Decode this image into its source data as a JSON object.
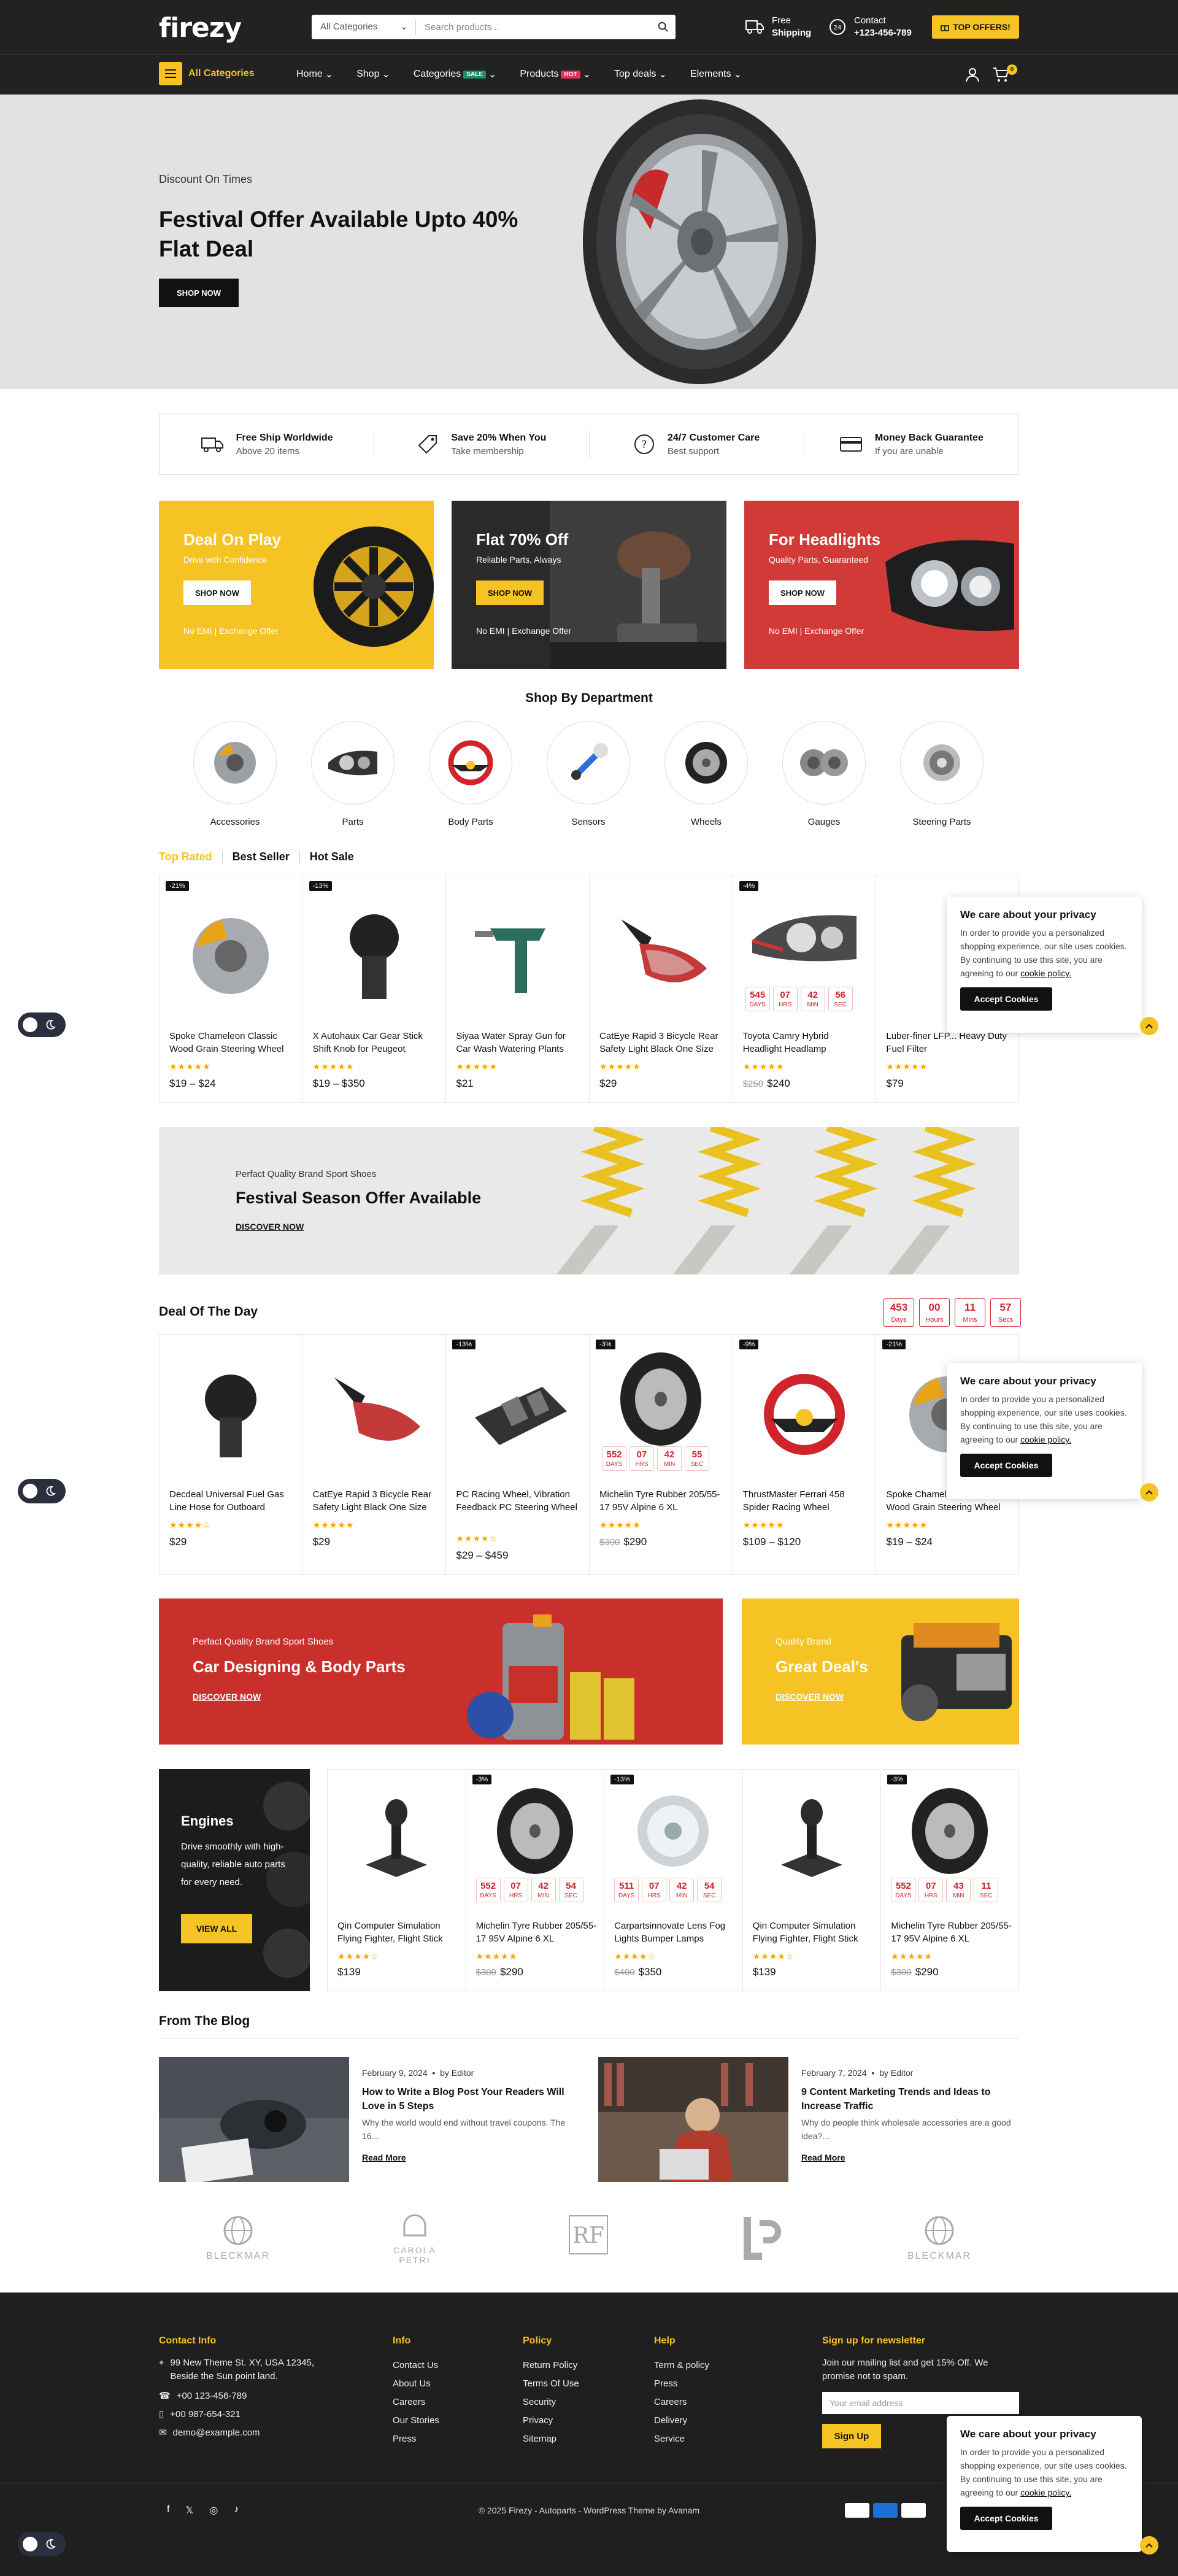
{
  "header": {
    "logo": "firezy",
    "search_category": "All Categories",
    "search_placeholder": "Search products...",
    "shipping_line1": "Free",
    "shipping_line2": "Shipping",
    "contact_line1": "Contact",
    "contact_line2": "+123-456-789",
    "offers_button": "TOP OFFERS!",
    "all_categories": "All Categories",
    "menu": [
      {
        "label": "Home",
        "tag": ""
      },
      {
        "label": "Shop",
        "tag": ""
      },
      {
        "label": "Categories",
        "tag": "SALE"
      },
      {
        "label": "Products",
        "tag": "HOT"
      },
      {
        "label": "Top deals",
        "tag": ""
      },
      {
        "label": "Elements",
        "tag": ""
      }
    ],
    "cart_count": "0",
    "colors": {
      "accent": "#f6c324",
      "dark": "#222222",
      "red": "#d0232a",
      "sale_tag": "#1f8f6a",
      "hot_tag": "#e0325a"
    }
  },
  "hero": {
    "subtitle": "Discount On Times",
    "title": "Festival Offer Available Upto 40% Flat Deal",
    "button": "SHOP NOW"
  },
  "features": [
    {
      "title": "Free Ship Worldwide",
      "sub": "Above 20 items",
      "icon": "truck-icon"
    },
    {
      "title": "Save 20% When You",
      "sub": "Take membership",
      "icon": "tag-icon"
    },
    {
      "title": "24/7 Customer Care",
      "sub": "Best support",
      "icon": "help-icon"
    },
    {
      "title": "Money Back Guarantee",
      "sub": "If you are unable",
      "icon": "card-icon"
    }
  ],
  "promos": [
    {
      "title": "Deal On Play",
      "sub": "Drive with Confidence",
      "button": "SHOP NOW",
      "foot": "No EMI | Exchange Offer"
    },
    {
      "title": "Flat 70% Off",
      "sub": "Reliable Parts, Always",
      "button": "SHOP NOW",
      "foot": "No EMI | Exchange Offer"
    },
    {
      "title": "For Headlights",
      "sub": "Quality Parts, Guaranteed",
      "button": "SHOP NOW",
      "foot": "No EMI | Exchange Offer"
    }
  ],
  "departments": {
    "title": "Shop By Department",
    "items": [
      "Accessories",
      "Parts",
      "Body Parts",
      "Sensors",
      "Wheels",
      "Gauges",
      "Steering Parts"
    ]
  },
  "tabs": [
    "Top Rated",
    "Best Seller",
    "Hot Sale"
  ],
  "top_rated": [
    {
      "name": "Spoke Chameleon Classic Wood Grain Steering Wheel",
      "price": "$19 – $24",
      "old": "",
      "badge": "-21%",
      "stars": "★★★★★"
    },
    {
      "name": "X Autohaux Car Gear Stick Shift Knob for Peugeot",
      "price": "$19 – $350",
      "old": "",
      "badge": "-13%",
      "stars": "★★★★★"
    },
    {
      "name": "Siyaa Water Spray Gun for Car Wash Watering Plants",
      "price": "$21",
      "old": "",
      "badge": "",
      "stars": "★★★★★"
    },
    {
      "name": "CatEye Rapid 3 Bicycle Rear Safety Light Black One Size",
      "price": "$29",
      "old": "",
      "badge": "",
      "stars": "★★★★★"
    },
    {
      "name": "Toyota Camry Hybrid Headlight Headlamp",
      "price": "$240",
      "old": "$250",
      "badge": "-4%",
      "stars": "★★★★★",
      "countdown": [
        [
          "545",
          "DAYS"
        ],
        [
          "07",
          "HRS"
        ],
        [
          "42",
          "MIN"
        ],
        [
          "56",
          "SEC"
        ]
      ]
    },
    {
      "name": "Luber-finer LFP... Heavy Duty Fuel Filter",
      "price": "$79",
      "old": "",
      "badge": "",
      "stars": "★★★★★"
    }
  ],
  "banner1": {
    "sub": "Perfact Quality Brand Sport Shoes",
    "title": "Festival Season Offer Available",
    "link": "DISCOVER NOW"
  },
  "deal": {
    "title": "Deal Of The Day",
    "countdown": [
      [
        "453",
        "Days"
      ],
      [
        "00",
        "Hours"
      ],
      [
        "11",
        "Mins"
      ],
      [
        "57",
        "Secs"
      ]
    ],
    "products": [
      {
        "name": "Decdeal Universal Fuel Gas Line Hose for Outboard",
        "price": "$29",
        "old": "",
        "badge": "",
        "stars": "★★★★☆"
      },
      {
        "name": "CatEye Rapid 3 Bicycle Rear Safety Light Black One Size",
        "price": "$29",
        "old": "",
        "badge": "",
        "stars": "★★★★★"
      },
      {
        "name": "PC Racing Wheel, Vibration Feedback PC Steering Wheel",
        "price": "$29 – $459",
        "old": "",
        "badge": "-13%",
        "stars": "★★★★☆"
      },
      {
        "name": "Michelin Tyre Rubber 205/55-17 95V Alpine 6 XL",
        "price": "$290",
        "old": "$300",
        "badge": "-3%",
        "stars": "★★★★★",
        "countdown": [
          [
            "552",
            "DAYS"
          ],
          [
            "07",
            "HRS"
          ],
          [
            "42",
            "MIN"
          ],
          [
            "55",
            "SEC"
          ]
        ]
      },
      {
        "name": "ThrustMaster Ferrari 458 Spider Racing Wheel",
        "price": "$109 – $120",
        "old": "",
        "badge": "-9%",
        "stars": "★★★★★"
      },
      {
        "name": "Spoke Chameleon Classic Wood Grain Steering Wheel",
        "price": "$19 – $24",
        "old": "",
        "badge": "-21%",
        "stars": "★★★★★"
      }
    ]
  },
  "banner_pair": {
    "left": {
      "sub": "Perfact Quality Brand Sport Shoes",
      "title": "Car Designing & Body Parts",
      "link": "DISCOVER NOW"
    },
    "right": {
      "sub": "Quality Brand",
      "title": "Great Deal's",
      "link": "DISCOVER NOW"
    }
  },
  "engines": {
    "title": "Engines",
    "desc": "Drive smoothly with high-quality, reliable auto parts for every need.",
    "button": "VIEW ALL",
    "products": [
      {
        "name": "Qin Computer Simulation Flying Fighter, Flight Stick",
        "price": "$139",
        "old": "",
        "badge": "",
        "stars": "★★★★☆"
      },
      {
        "name": "Michelin Tyre Rubber 205/55-17 95V Alpine 6 XL",
        "price": "$290",
        "old": "$300",
        "badge": "-3%",
        "stars": "★★★★★",
        "countdown": [
          [
            "552",
            "DAYS"
          ],
          [
            "07",
            "HRS"
          ],
          [
            "42",
            "MIN"
          ],
          [
            "54",
            "SEC"
          ]
        ]
      },
      {
        "name": "Carpartsinnovate Lens Fog Lights Bumper Lamps",
        "price": "$350",
        "old": "$400",
        "badge": "-13%",
        "stars": "★★★★☆",
        "countdown": [
          [
            "511",
            "DAYS"
          ],
          [
            "07",
            "HRS"
          ],
          [
            "42",
            "MIN"
          ],
          [
            "54",
            "SEC"
          ]
        ]
      },
      {
        "name": "Qin Computer Simulation Flying Fighter, Flight Stick",
        "price": "$139",
        "old": "",
        "badge": "",
        "stars": "★★★★☆"
      },
      {
        "name": "Michelin Tyre Rubber 205/55-17 95V Alpine 6 XL",
        "price": "$290",
        "old": "$300",
        "badge": "-3%",
        "stars": "★★★★★",
        "countdown": [
          [
            "552",
            "DAYS"
          ],
          [
            "07",
            "HRS"
          ],
          [
            "43",
            "MIN"
          ],
          [
            "11",
            "SEC"
          ]
        ]
      }
    ]
  },
  "blog": {
    "title": "From The Blog",
    "posts": [
      {
        "date": "February 9, 2024",
        "author": "by Editor",
        "title": "How to Write a Blog Post Your Readers Will Love in 5 Steps",
        "excerpt": "Why the world would end without travel coupons. The 16...",
        "more": "Read More"
      },
      {
        "date": "February 7, 2024",
        "author": "by Editor",
        "title": "9 Content Marketing Trends and Ideas to Increase Traffic",
        "excerpt": "Why do people think wholesale accessories are a good idea?...",
        "more": "Read More"
      }
    ]
  },
  "brands": [
    "BLECKMAR",
    "CAROLA PETRI",
    "",
    "",
    "BLECKMAR"
  ],
  "footer": {
    "contact": {
      "title": "Contact Info",
      "address": "99 New Theme St. XY, USA 12345, Beside the Sun point land.",
      "phone1": "+00 123-456-789",
      "phone2": "+00 987-654-321",
      "email": "demo@example.com"
    },
    "info": {
      "title": "Info",
      "links": [
        "Contact Us",
        "About Us",
        "Careers",
        "Our Stories",
        "Press"
      ]
    },
    "policy": {
      "title": "Policy",
      "links": [
        "Return Policy",
        "Terms Of Use",
        "Security",
        "Privacy",
        "Sitemap"
      ]
    },
    "help": {
      "title": "Help",
      "links": [
        "Term & policy",
        "Press",
        "Careers",
        "Delivery",
        "Service"
      ]
    },
    "newsletter": {
      "title": "Sign up for newsletter",
      "text": "Join our mailing list and get 15% Off. We promise not to spam.",
      "placeholder": "Your email address",
      "button": "Sign Up"
    },
    "copyright": "© 2025 Firezy - Autoparts - WordPress Theme by Avanam"
  },
  "cookie": {
    "title": "We care about your privacy",
    "text": "In order to provide you a personalized shopping experience, our site uses cookies. By continuing to use this site, you are agreeing to our",
    "link": "cookie policy.",
    "button": "Accept Cookies"
  }
}
